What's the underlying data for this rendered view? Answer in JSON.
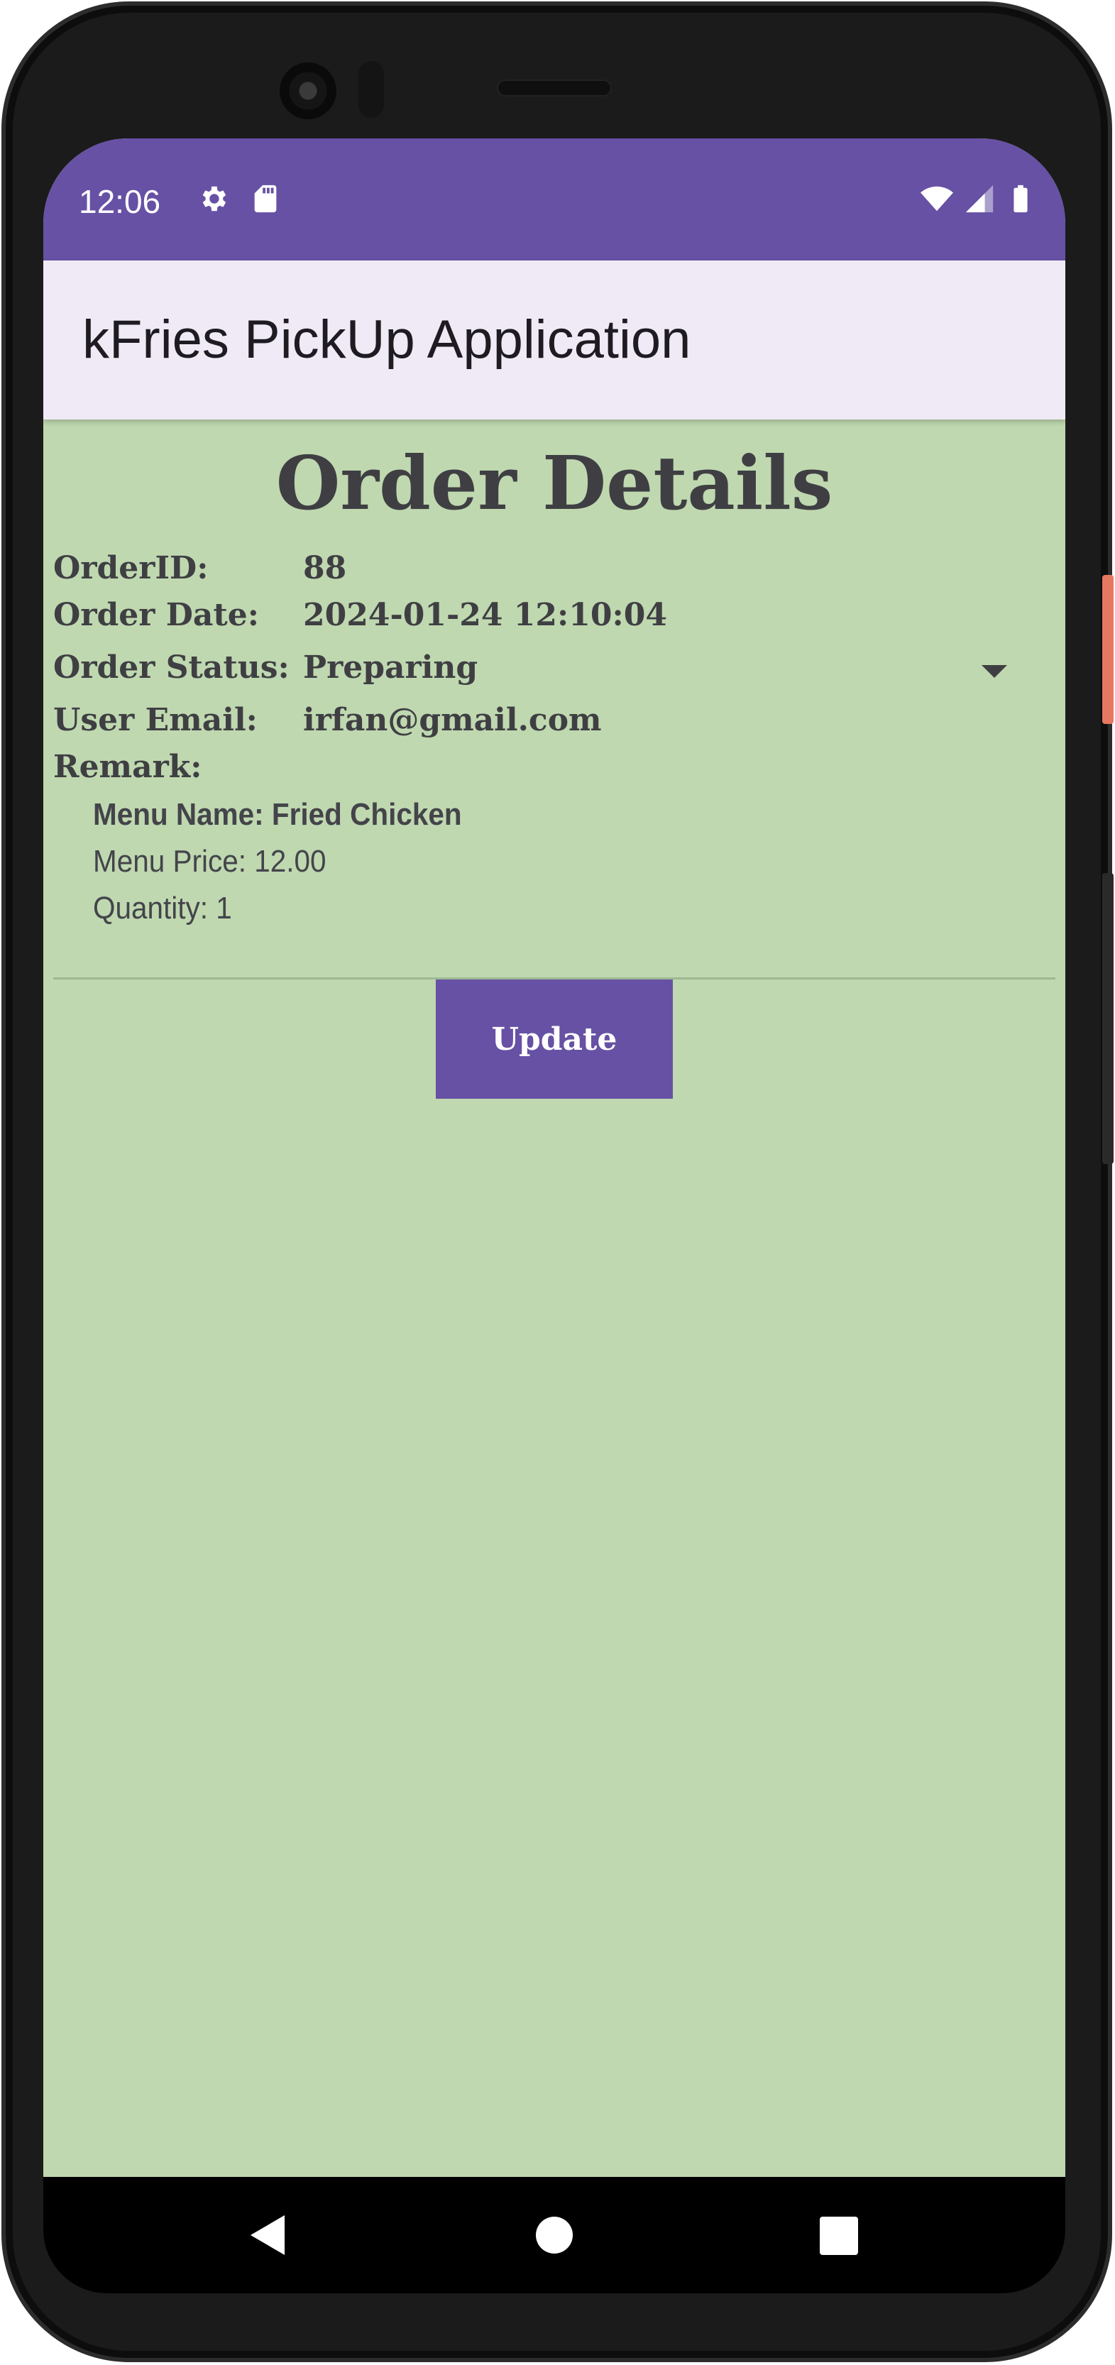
{
  "status_bar": {
    "time": "12:06",
    "icons_left": [
      "gear-icon",
      "sd-card-icon"
    ],
    "icons_right": [
      "wifi-icon",
      "cell-signal-icon",
      "battery-icon"
    ],
    "color": "#6751a4"
  },
  "app_bar": {
    "title": "kFries PickUp Application",
    "background": "#f0eaf6"
  },
  "page": {
    "title": "Order Details",
    "background": "#bfd8b0"
  },
  "order": {
    "id_label": "OrderID:",
    "id_value": "88",
    "date_label": "Order Date:",
    "date_value": "2024-01-24 12:10:04",
    "status_label": "Order Status:",
    "status_value": "Preparing",
    "email_label": "User Email:",
    "email_value": "irfan@gmail.com",
    "remark_label": "Remark:",
    "remark_value": ""
  },
  "items": [
    {
      "name": "Menu Name: Fried Chicken",
      "price": "Menu Price: 12.00",
      "quantity": "Quantity: 1"
    }
  ],
  "update_button": {
    "label": "Update",
    "color": "#6751a4"
  },
  "nav_bar": {
    "icons": [
      "back-icon",
      "home-icon",
      "recent-apps-icon"
    ]
  }
}
